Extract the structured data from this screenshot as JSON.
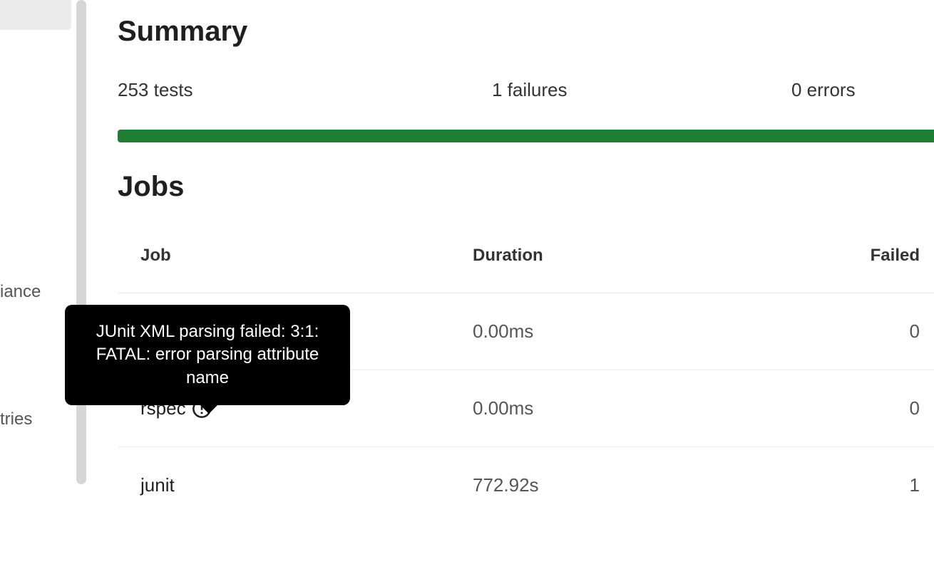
{
  "sidebar": {
    "item1": "iance",
    "item2": "tries"
  },
  "summary": {
    "title": "Summary",
    "tests": "253 tests",
    "failures": "1 failures",
    "errors": "0 errors"
  },
  "jobs": {
    "title": "Jobs",
    "headers": {
      "job": "Job",
      "duration": "Duration",
      "failed": "Failed"
    },
    "rows": [
      {
        "name": "",
        "duration": "0.00ms",
        "failed": "0",
        "has_warning": false
      },
      {
        "name": "rspec",
        "duration": "0.00ms",
        "failed": "0",
        "has_warning": true
      },
      {
        "name": "junit",
        "duration": "772.92s",
        "failed": "1",
        "has_warning": false
      }
    ]
  },
  "tooltip": {
    "text": "JUnit XML parsing failed: 3:1: FATAL: error parsing attribute name"
  }
}
